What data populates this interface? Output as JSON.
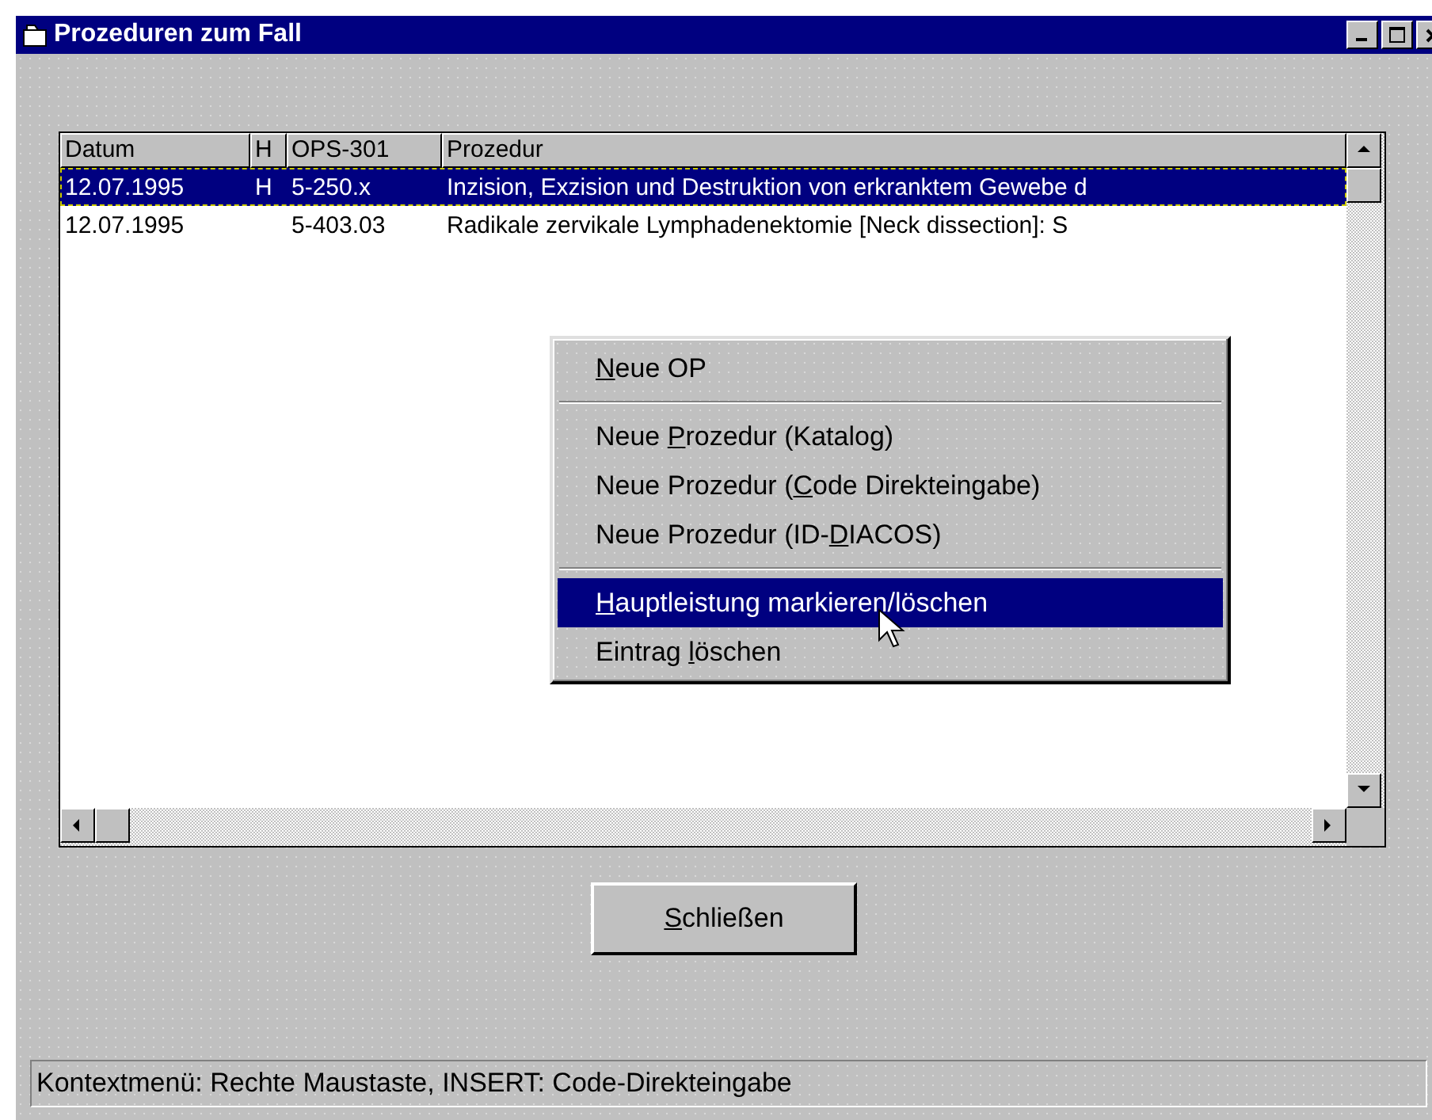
{
  "window": {
    "title": "Prozeduren zum Fall"
  },
  "table": {
    "columns": [
      "Datum",
      "H",
      "OPS-301",
      "Prozedur"
    ],
    "rows": [
      {
        "cells": [
          "12.07.1995",
          "H",
          "5-250.x",
          "Inzision, Exzision und Destruktion von erkranktem Gewebe d"
        ],
        "selected": true
      },
      {
        "cells": [
          "12.07.1995",
          "",
          "5-403.03",
          "Radikale zervikale Lymphadenektomie [Neck dissection]: S"
        ],
        "selected": false
      }
    ]
  },
  "context_menu": {
    "groups": [
      [
        {
          "key": "N",
          "post": "eue OP",
          "selected": false
        }
      ],
      [
        {
          "pre": "Neue ",
          "key": "P",
          "post": "rozedur (Katalog)",
          "selected": false
        },
        {
          "pre": "Neue Prozedur (",
          "key": "C",
          "post": "ode Direkteingabe)",
          "selected": false
        },
        {
          "pre": "Neue Prozedur (ID-",
          "key": "D",
          "post": "IACOS)",
          "selected": false
        }
      ],
      [
        {
          "key": "H",
          "post": "auptleistung markieren/löschen",
          "selected": true
        },
        {
          "pre": "Eintrag ",
          "key": "l",
          "post": "öschen",
          "selected": false
        }
      ]
    ]
  },
  "close_button": {
    "key": "S",
    "post": "chließen"
  },
  "status_bar": "Kontextmenü: Rechte Maustaste, INSERT: Code-Direkteingabe"
}
